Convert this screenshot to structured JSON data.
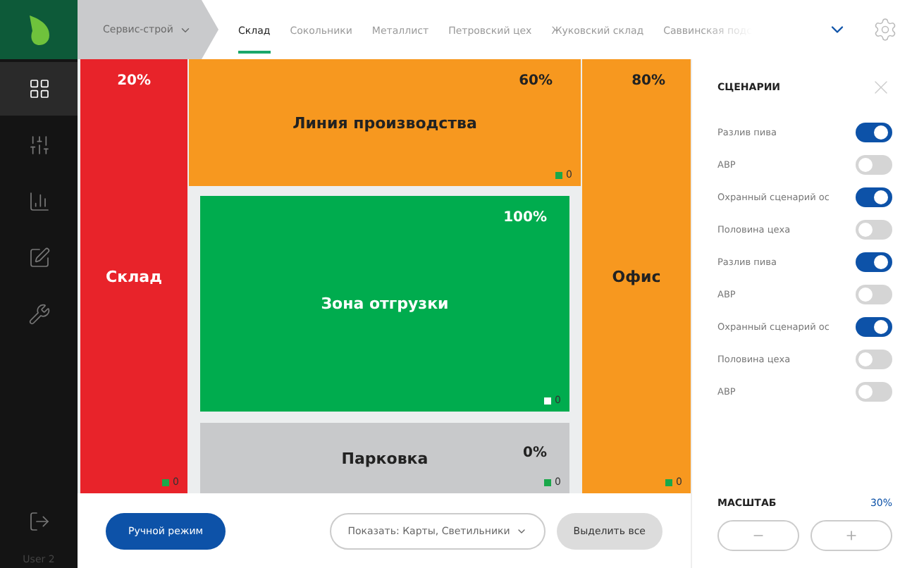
{
  "sidebar": {
    "items": [
      {
        "selected": true
      },
      {
        "selected": false
      },
      {
        "selected": false
      },
      {
        "selected": false
      },
      {
        "selected": false
      }
    ],
    "user": "User 2"
  },
  "topbar": {
    "object": "Сервис-строй",
    "tabs": [
      {
        "label": "Склад",
        "selected": true
      },
      {
        "label": "Сокольники",
        "selected": false
      },
      {
        "label": "Металлист",
        "selected": false
      },
      {
        "label": "Петровский цех",
        "selected": false
      },
      {
        "label": "Жуковский склад",
        "selected": false
      },
      {
        "label": "Саввинская подс",
        "selected": false
      }
    ]
  },
  "map": {
    "left": {
      "name": "Склад",
      "percent": "20%",
      "count": "0",
      "color": "#e8232a"
    },
    "top": {
      "name": "Линия производства",
      "percent": "60%",
      "count": "0",
      "color": "#f7981f"
    },
    "center": {
      "name": "Зона отгрузки",
      "percent": "100%",
      "count": "0",
      "color": "#00ac4e"
    },
    "bottom": {
      "name": "Парковка",
      "percent": "0%",
      "count": "0",
      "color": "#c8c9cb"
    },
    "right": {
      "name": "Офис",
      "percent": "80%",
      "count": "0",
      "color": "#f7981f"
    }
  },
  "bottom_bar": {
    "manual": "Ручной режим",
    "show": "Показать: Карты, Светильники",
    "select_all": "Выделить все"
  },
  "panel": {
    "title": "СЦЕНАРИИ",
    "scenarios": [
      {
        "label": "Разлив пива",
        "on": true
      },
      {
        "label": "АВР",
        "on": false
      },
      {
        "label": "Охранный сценарий ос",
        "on": true
      },
      {
        "label": "Половина цеха",
        "on": false
      },
      {
        "label": "Разлив пива",
        "on": true
      },
      {
        "label": "АВР",
        "on": false
      },
      {
        "label": "Охранный сценарий ос",
        "on": true
      },
      {
        "label": "Половина цеха",
        "on": false
      },
      {
        "label": "АВР",
        "on": false
      }
    ],
    "scale_label": "МАСШТАБ",
    "scale_value": "30%"
  }
}
